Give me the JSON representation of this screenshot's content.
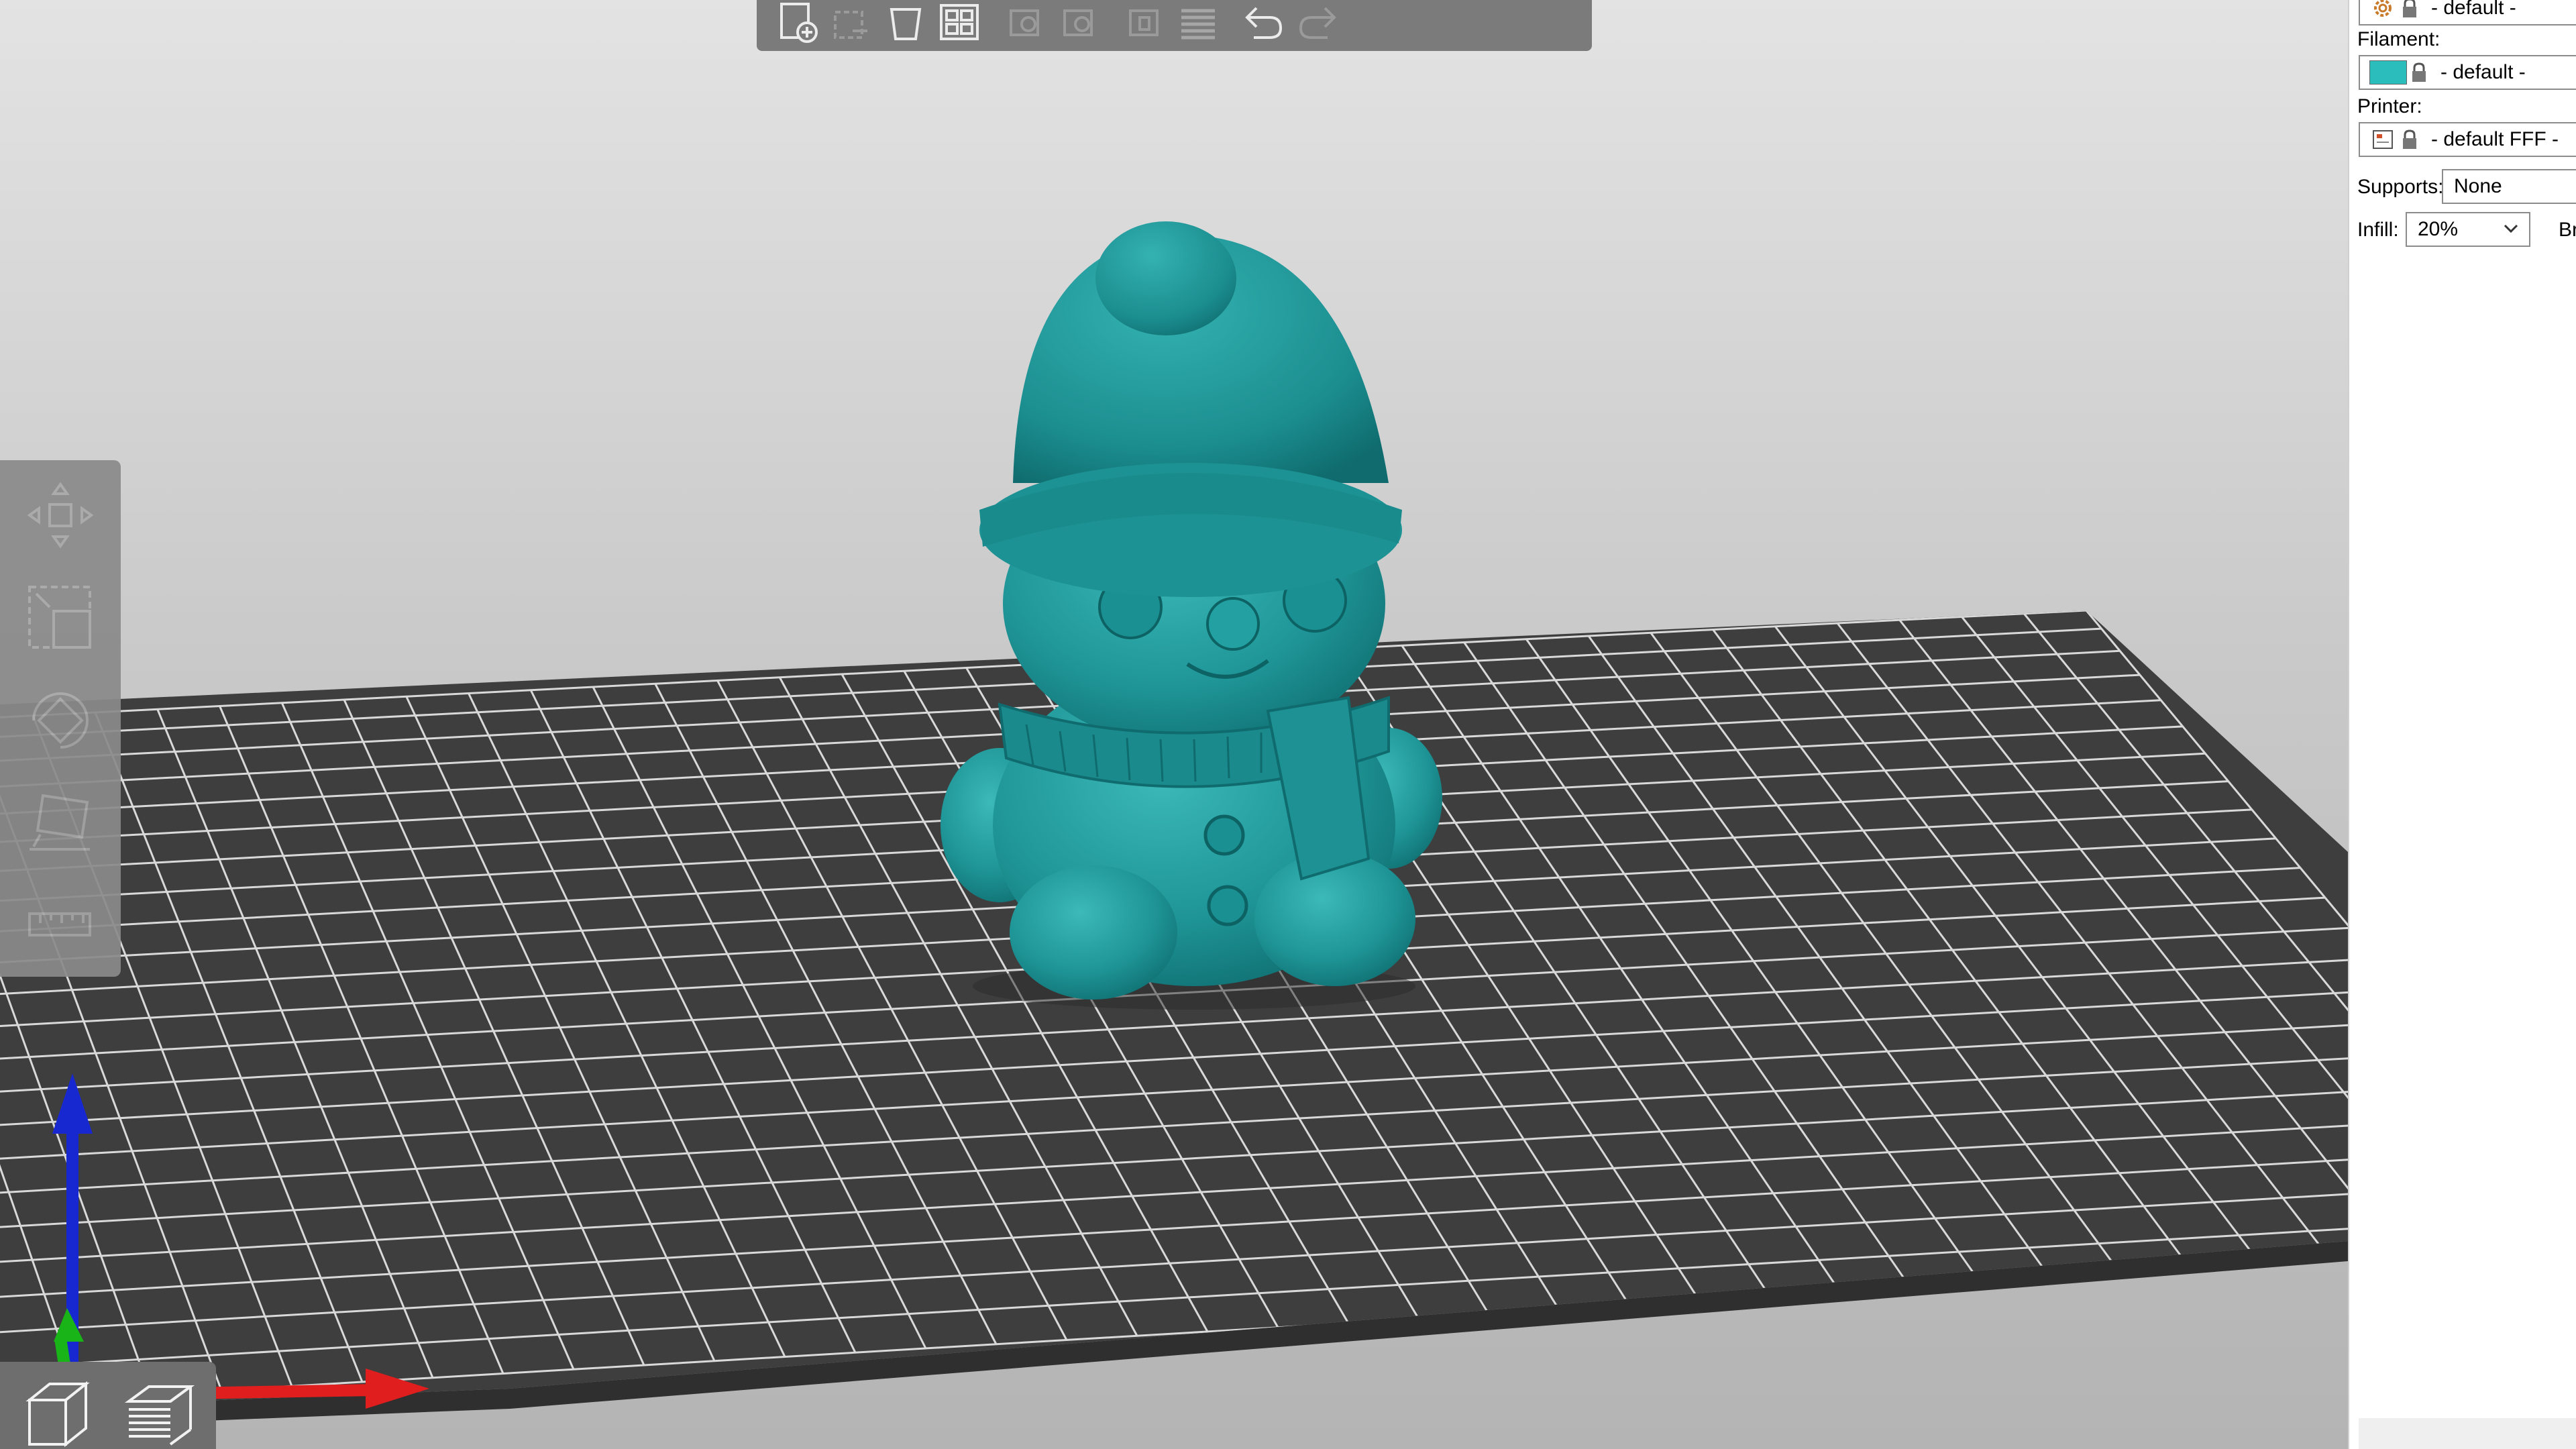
{
  "sidebar": {
    "print_settings": {
      "value": "- default -"
    },
    "filament": {
      "label": "Filament:",
      "value": "- default -",
      "color": "#2bbcbc"
    },
    "printer": {
      "label": "Printer:",
      "value": "- default FFF -"
    },
    "supports": {
      "label": "Supports:",
      "value": "None"
    },
    "infill": {
      "label": "Infill:",
      "value": "20%"
    },
    "brim": {
      "label_partial": "Br"
    }
  },
  "top_toolbar": {
    "buttons": [
      "add-icon",
      "delete-icon",
      "delete-all-icon",
      "arrange-icon",
      "copy-icon",
      "paste-icon",
      "instances-icon",
      "layers-icon",
      "undo-icon",
      "redo-icon"
    ]
  },
  "left_toolbar": {
    "tools": [
      "move-icon",
      "scale-icon",
      "rotate-icon",
      "place-on-face-icon",
      "measure-icon"
    ]
  },
  "view_switch": {
    "buttons": [
      "3d-view-icon",
      "preview-icon"
    ]
  },
  "model": {
    "color": "#1e9496",
    "highlight": "#38b6b6",
    "shadow": "#0f6b6d"
  },
  "axes": {
    "x_color": "#e01e1e",
    "y_color": "#18b418",
    "z_color": "#1828d0"
  },
  "bed": {
    "color": "#3e3e3e",
    "grid_color": "#d8d8d8"
  }
}
